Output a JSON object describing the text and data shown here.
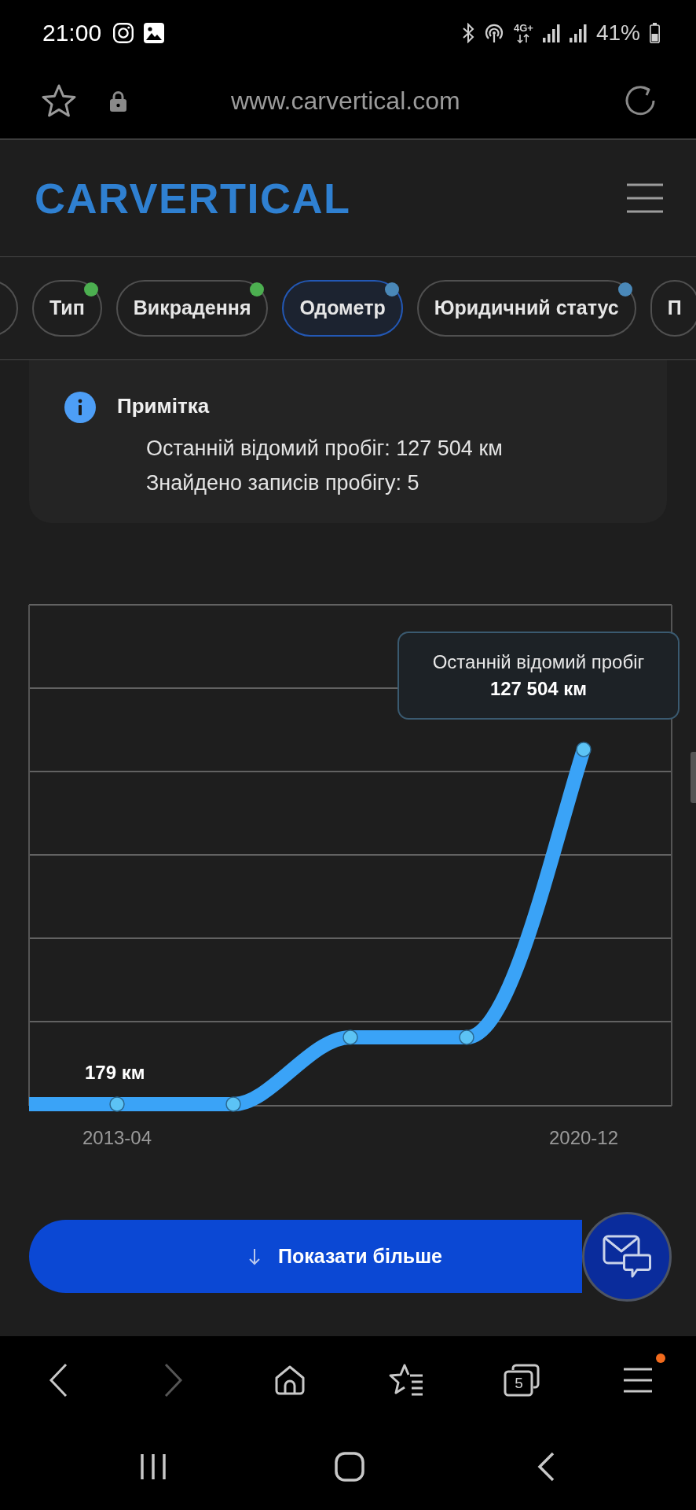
{
  "status_bar": {
    "time": "21:00",
    "network": "4G+",
    "battery": "41%"
  },
  "address_bar": {
    "url": "www.carvertical.com"
  },
  "header": {
    "logo": "CARVERTICAL"
  },
  "tabs": [
    {
      "selected": false
    },
    {
      "label": "Тип",
      "selected": false,
      "color": "#4caf50"
    },
    {
      "label": "Викрадення",
      "selected": false,
      "color": "#4caf50"
    },
    {
      "label": "Одометр",
      "selected": true,
      "color": "#4a88b8"
    },
    {
      "label": "Юридичний статус",
      "selected": false,
      "color": "#4a88b8"
    },
    {
      "label": "П",
      "selected": false
    }
  ],
  "note": {
    "title": "Примітка",
    "lines": [
      "Останній відомий пробіг: 127 504 км",
      "Знайдено записів пробігу: 5"
    ]
  },
  "chart": {
    "tooltip": {
      "label": "Останній відомий пробіг",
      "value": "127 504 км"
    },
    "first_point_label": "179 км",
    "x_labels": [
      "2013-04",
      "2020-12"
    ]
  },
  "show_more_button": {
    "label": "Показати більше"
  },
  "toolbar": {
    "back_enabled": true,
    "forward_enabled": false,
    "tab_count": "5",
    "menu_badge": true
  }
}
